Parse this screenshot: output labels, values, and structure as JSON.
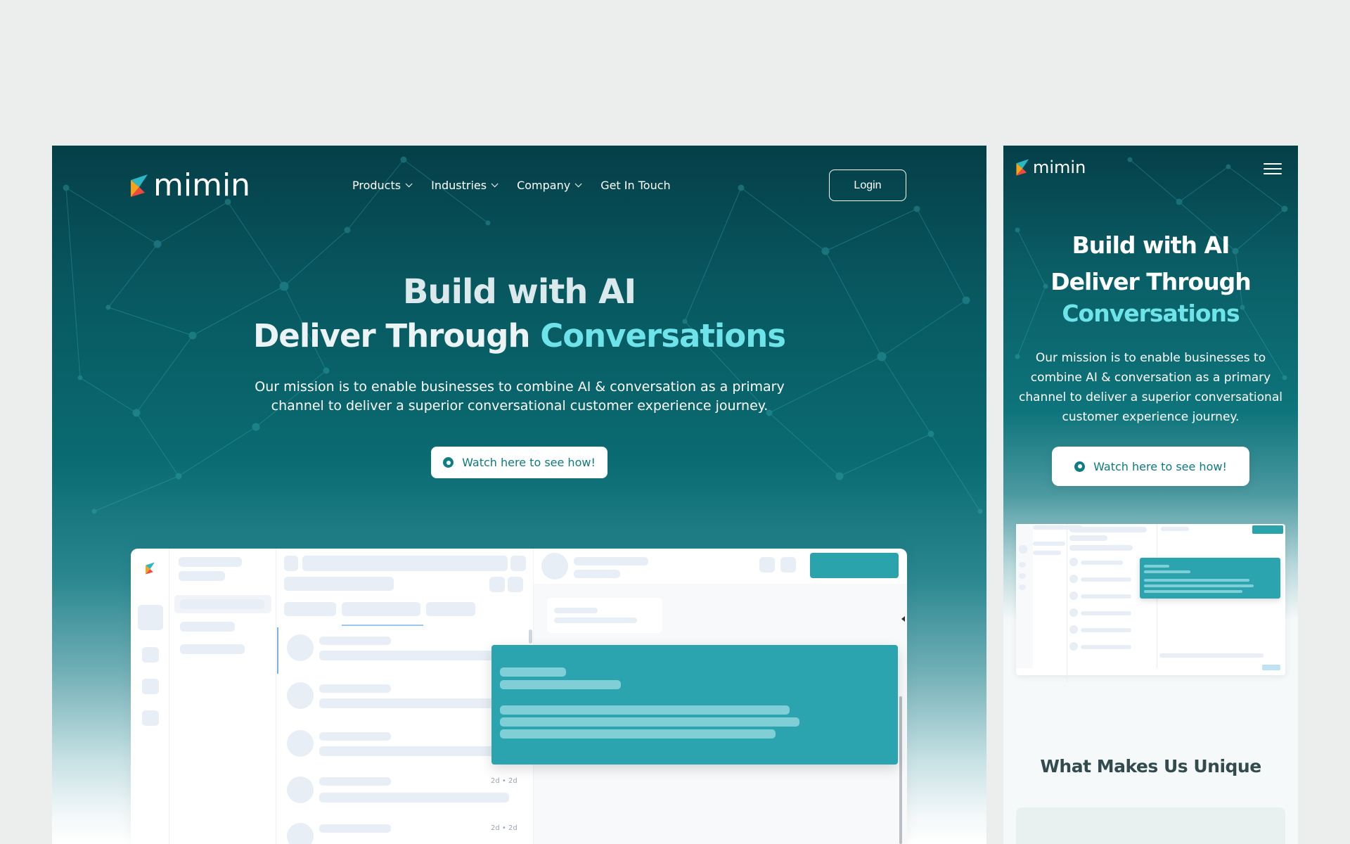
{
  "brand": {
    "name": "mimin"
  },
  "desktop": {
    "nav": [
      {
        "label": "Products",
        "dropdown": true
      },
      {
        "label": "Industries",
        "dropdown": true
      },
      {
        "label": "Company",
        "dropdown": true
      },
      {
        "label": "Get In Touch",
        "dropdown": false
      }
    ],
    "login_label": "Login",
    "hero": {
      "line1": "Build with AI",
      "line2_plain": "Deliver Through ",
      "line2_accent": "Conversations",
      "mission": "Our mission is to enable businesses to combine AI & conversation as a primary channel to deliver a superior conversational customer experience journey.",
      "cta": "Watch here to see how!"
    },
    "mock": {
      "time_label": "2d • 2d"
    }
  },
  "mobile": {
    "hero": {
      "line1": "Build with AI",
      "line2": "Deliver Through",
      "line3": "Conversations",
      "mission": "Our mission is to enable businesses to combine AI & conversation as a primary channel to deliver a superior conversational customer experience journey.",
      "cta": "Watch here to see how!"
    },
    "section_title": "What Makes Us Unique"
  },
  "colors": {
    "teal_dark": "#053f48",
    "accent": "#6ee3e9",
    "card_teal": "#2ca4af"
  },
  "icons": [
    "logo-mark-icon",
    "chevron-down-icon",
    "play-icon",
    "hamburger-menu-icon"
  ]
}
